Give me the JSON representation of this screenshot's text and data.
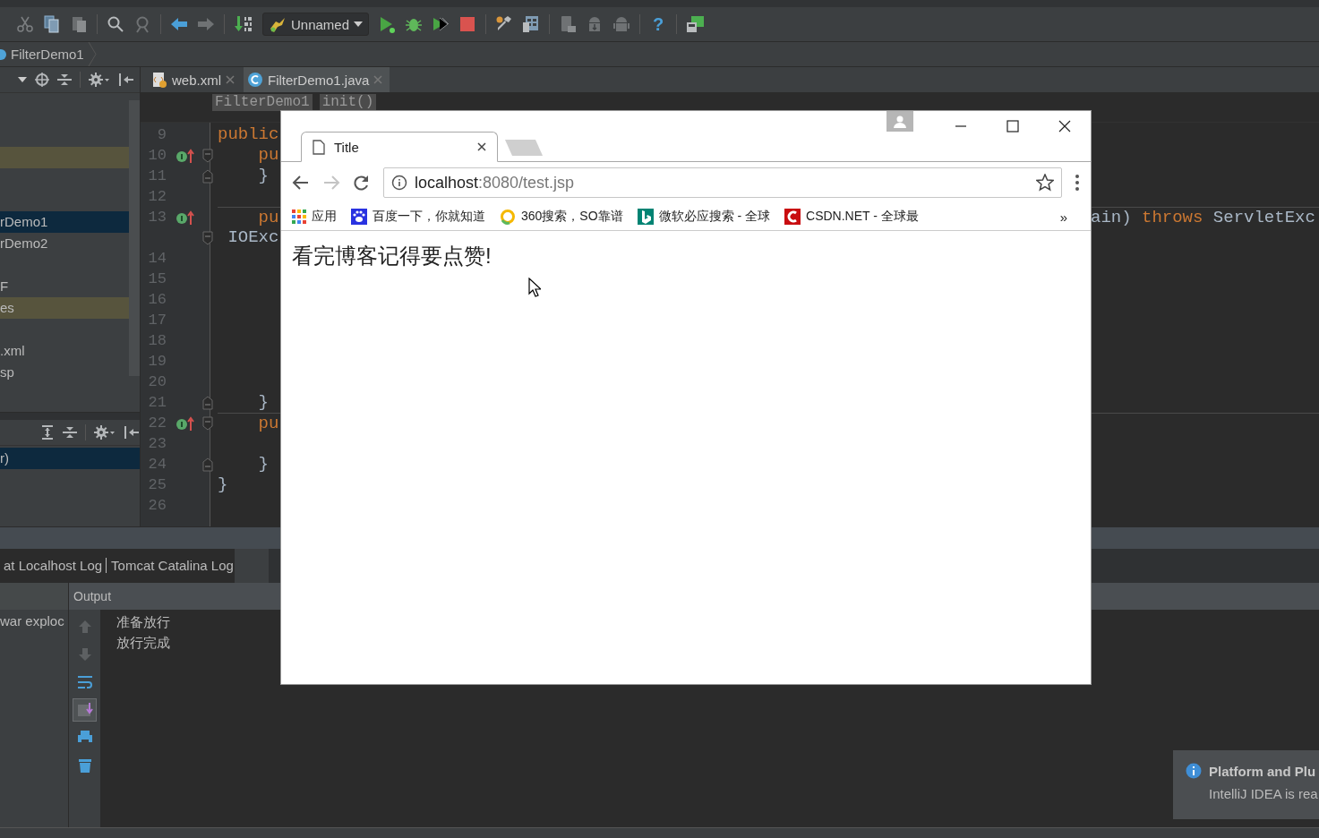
{
  "toolbar": {
    "run_config": "Unnamed",
    "help": "?"
  },
  "navigation": {
    "crumbs": [
      "FilterDemo1"
    ]
  },
  "project_panel": {
    "tree": [
      {
        "selected": false,
        "highlighted": false
      },
      {
        "selected": false,
        "highlighted": false
      },
      {
        "selected": false,
        "highlighted": true
      },
      {
        "selected": false,
        "highlighted": false
      },
      {
        "selected": false,
        "highlighted": false
      },
      {
        "label": "rDemo1",
        "selected": true,
        "highlighted": false
      },
      {
        "label": "rDemo2",
        "selected": false,
        "highlighted": false
      },
      {
        "selected": false,
        "highlighted": false
      },
      {
        "label": "F",
        "selected": false,
        "highlighted": false
      },
      {
        "label": "es",
        "selected": false,
        "highlighted": true
      },
      {
        "selected": false,
        "highlighted": false
      },
      {
        "label": ".xml",
        "selected": false,
        "highlighted": false
      },
      {
        "label": "sp",
        "selected": false,
        "highlighted": false
      }
    ],
    "structure": [
      {
        "label": "r)",
        "selected": true
      }
    ]
  },
  "editor": {
    "tabs": [
      {
        "label": "web.xml",
        "kind": "xml",
        "selected": false
      },
      {
        "label": "FilterDemo1.java",
        "kind": "class",
        "selected": true
      }
    ],
    "breadcrumbs": [
      "FilterDemo1",
      "init()"
    ],
    "lines": [
      {
        "number": "9",
        "override": false,
        "separator": false,
        "fold_start": false,
        "fold_end": false,
        "code": [
          {
            "text": "public",
            "kind": "keyword"
          }
        ]
      },
      {
        "number": "10",
        "override": true,
        "separator": false,
        "fold_start": true,
        "fold_end": false,
        "code": [
          {
            "text": "    pu",
            "kind": "keyword"
          }
        ]
      },
      {
        "number": "11",
        "override": false,
        "separator": false,
        "fold_start": false,
        "fold_end": true,
        "code": [
          {
            "text": "    }",
            "kind": "plain"
          }
        ]
      },
      {
        "number": "12",
        "override": false,
        "separator": false,
        "fold_start": false,
        "fold_end": false
      },
      {
        "number": "13",
        "override": true,
        "separator": true,
        "fold_start": false,
        "fold_end": false,
        "code": [
          {
            "text": "    pu",
            "kind": "keyword"
          }
        ],
        "right": [
          {
            "text": "ain) ",
            "kind": "plain"
          },
          {
            "text": "throws",
            "kind": "keyword"
          },
          {
            "text": " ServletExc",
            "kind": "plain"
          }
        ]
      },
      {
        "override": false,
        "separator": false,
        "fold_start": true,
        "fold_end": false,
        "code": [
          {
            "text": " IOExc",
            "kind": "plain"
          }
        ]
      },
      {
        "number": "14",
        "override": false,
        "separator": false,
        "fold_start": false,
        "fold_end": false
      },
      {
        "number": "15",
        "override": false,
        "separator": false,
        "fold_start": false,
        "fold_end": false
      },
      {
        "number": "16",
        "override": false,
        "separator": false,
        "fold_start": false,
        "fold_end": false
      },
      {
        "number": "17",
        "override": false,
        "separator": false,
        "fold_start": false,
        "fold_end": false
      },
      {
        "number": "18",
        "override": false,
        "separator": false,
        "fold_start": false,
        "fold_end": false
      },
      {
        "number": "19",
        "override": false,
        "separator": false,
        "fold_start": false,
        "fold_end": false
      },
      {
        "number": "20",
        "override": false,
        "separator": false,
        "fold_start": false,
        "fold_end": false
      },
      {
        "number": "21",
        "override": false,
        "separator": false,
        "fold_start": false,
        "fold_end": true,
        "code": [
          {
            "text": "    }",
            "kind": "plain"
          }
        ]
      },
      {
        "number": "22",
        "override": true,
        "separator": true,
        "fold_start": true,
        "fold_end": false,
        "code": [
          {
            "text": "    pu",
            "kind": "keyword"
          }
        ]
      },
      {
        "number": "23",
        "override": false,
        "separator": false,
        "fold_start": false,
        "fold_end": false
      },
      {
        "number": "24",
        "override": false,
        "separator": false,
        "fold_start": false,
        "fold_end": true,
        "code": [
          {
            "text": "    }",
            "kind": "plain"
          }
        ]
      },
      {
        "number": "25",
        "override": false,
        "separator": false,
        "fold_start": false,
        "fold_end": false,
        "code": [
          {
            "text": "}",
            "kind": "plain"
          }
        ]
      },
      {
        "number": "26",
        "override": false,
        "separator": false,
        "fold_start": false,
        "fold_end": false
      }
    ]
  },
  "run_panel": {
    "tabs": [
      "at Localhost Log",
      "Tomcat Catalina Log"
    ],
    "deployment": "war exploc",
    "output_title": "Output",
    "output_tools": [
      {
        "kind": "up",
        "disabled": true,
        "selected": false
      },
      {
        "kind": "down",
        "disabled": true,
        "selected": false
      },
      {
        "kind": "wrap",
        "disabled": false,
        "selected": false
      },
      {
        "kind": "scroll",
        "disabled": false,
        "selected": true
      },
      {
        "kind": "print",
        "disabled": false,
        "selected": false
      },
      {
        "kind": "trash",
        "disabled": false,
        "selected": false
      }
    ],
    "output": [
      "准备放行",
      "放行完成"
    ]
  },
  "browser": {
    "tab_title": "Title",
    "forward_disabled": true,
    "url_host": "localhost",
    "url_rest": ":8080/test.jsp",
    "bookmarks": [
      {
        "label": "应用",
        "kind": "apps"
      },
      {
        "label": "百度一下，你就知道",
        "kind": "paw"
      },
      {
        "label": "360搜索，SO靠谱",
        "kind": "ring"
      },
      {
        "label": "微软必应搜索 - 全球",
        "kind": "bing"
      },
      {
        "label": "CSDN.NET - 全球最",
        "kind": "csdn"
      }
    ],
    "more": "»",
    "page_text": "看完博客记得要点赞!"
  },
  "notification": {
    "title": "Platform and Plu",
    "body": "IntelliJ IDEA is rea"
  }
}
